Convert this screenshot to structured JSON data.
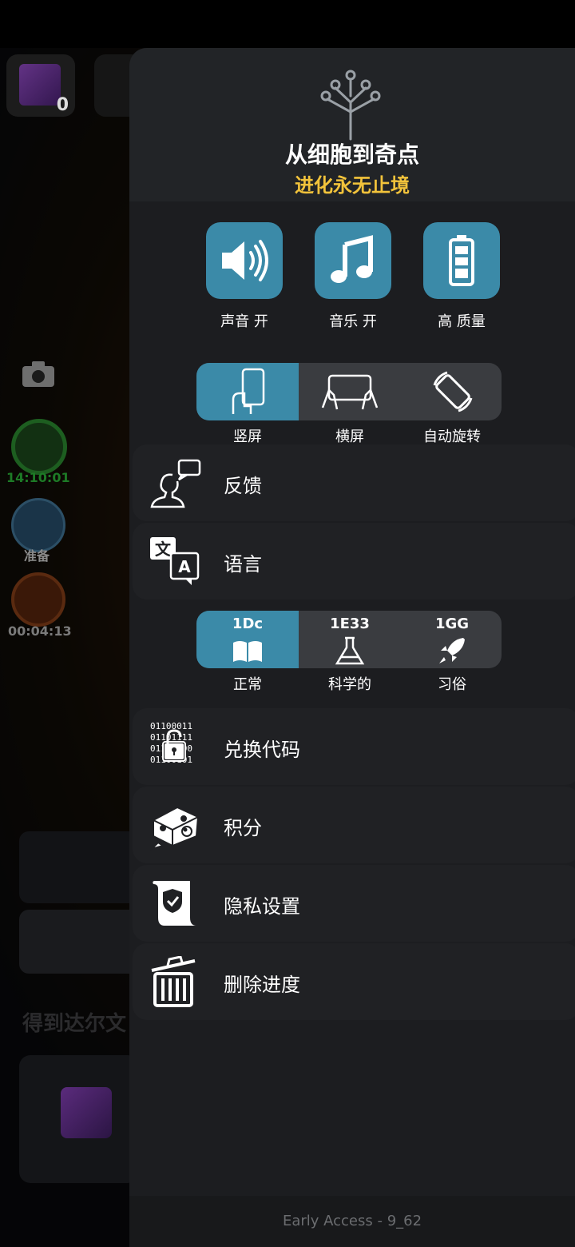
{
  "background_game": {
    "cube_count": "0",
    "timer_text": "14:10:01",
    "ghost_label": "准备",
    "calendar_text": "00:04:13",
    "darwin_text": "得到达尔文"
  },
  "drawer": {
    "title": "从细胞到奇点",
    "subtitle": "进化永无止境",
    "toggles": [
      {
        "label": "声音 开",
        "icon": "speaker-icon"
      },
      {
        "label": "音乐 开",
        "icon": "music-note-icon"
      },
      {
        "label": "高 质量",
        "icon": "battery-icon"
      }
    ],
    "orientation": {
      "selected": "竖屏",
      "options": [
        {
          "label": "竖屏",
          "icon": "portrait-phone-icon"
        },
        {
          "label": "横屏",
          "icon": "landscape-phone-icon"
        },
        {
          "label": "自动旋转",
          "icon": "rotate-icon"
        }
      ]
    },
    "menu_top": [
      {
        "label": "反馈",
        "icon": "feedback-person-icon"
      },
      {
        "label": "语言",
        "icon": "translate-icon"
      }
    ],
    "number_format": {
      "selected": "正常",
      "options": [
        {
          "value": "1Dc",
          "label": "正常",
          "icon": "book-icon"
        },
        {
          "value": "1E33",
          "label": "科学的",
          "icon": "flask-icon"
        },
        {
          "value": "1GG",
          "label": "习俗",
          "icon": "rocket-icon"
        }
      ]
    },
    "menu_bottom": [
      {
        "label": "兑换代码",
        "icon": "binary-lock-icon"
      },
      {
        "label": "积分",
        "icon": "cheese-mouse-icon"
      },
      {
        "label": "隐私设置",
        "icon": "privacy-scroll-icon"
      },
      {
        "label": "删除进度",
        "icon": "trash-icon"
      }
    ],
    "version": "Early Access - 9_62"
  }
}
